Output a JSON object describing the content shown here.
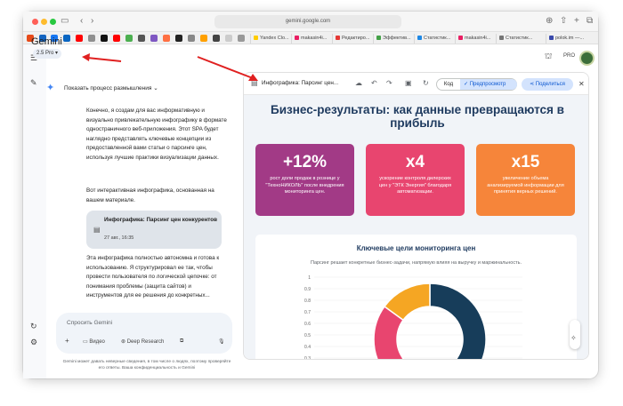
{
  "browser": {
    "url": "gemini.google.com",
    "tabs": [
      "Yandex Clo...",
      "makasin4i...",
      "Редактиро...",
      "Эффектив...",
      "Статистик...",
      "makasin4i...",
      "Статистик...",
      "polok.im —..."
    ]
  },
  "app": {
    "title": "Gemini",
    "model": "2.5 Pro",
    "pro_label": "PRO"
  },
  "chat": {
    "thinking_label": "Показать процесс размышления",
    "para1": "Конечно, я создам для вас информативную и визуально привлекательную инфографику в формате одностраничного веб-приложения. Этот SPA будет наглядно представлять ключевые концепции из предоставленной вами статьи о парсинге цен, используя лучшие практики визуализации данных.",
    "para2": "Вот интерактивная инфографика, основанная на вашем материале.",
    "card_title": "Инфографика: Парсинг цен конкурентов",
    "card_date": "27 авг., 16:35",
    "para3": "Эта инфографика полностью автономна и готова к использованию. Я структурировал ее так, чтобы провести пользователя по логической цепочке: от понимания проблемы (защита сайтов) и инструментов для ее решения до конкретных..."
  },
  "composer": {
    "placeholder": "Спросить Gemini",
    "video": "Видео",
    "deep_research": "Deep Research"
  },
  "disclaimer": "Gemini может давать неверные сведения, в том числе о людях, поэтому проверяйте его ответы. Ваша конфиденциальность и Gemini",
  "panel": {
    "title": "Инфографика: Парсинг цен...",
    "code_label": "Код",
    "preview_label": "Предпросмотр",
    "share_label": "Поделиться",
    "headline": "Бизнес-результаты: как данные превращаются в прибыль",
    "stats": [
      {
        "value": "+12%",
        "desc": "рост доли продаж в рознице у \"ТехноНИКОЛЬ\" после внедрения мониторинга цен.",
        "color": "#a23a86"
      },
      {
        "value": "x4",
        "desc": "ускорение контроля дилерских цен у \"ЭТК Энергия\" благодаря автоматизации.",
        "color": "#e8456f"
      },
      {
        "value": "x15",
        "desc": "увеличение объема анализируемой информации для принятия верных решений.",
        "color": "#f6853a"
      }
    ],
    "goals_title": "Ключевые цели мониторинга цен",
    "goals_subtitle": "Парсинг решает конкретные бизнес-задачи, напрямую влияя на выручку и маржинальность."
  },
  "chart_data": {
    "type": "pie",
    "title": "Ключевые цели мониторинга цен",
    "y_ticks": [
      "1",
      "0.9",
      "0.8",
      "0.7",
      "0.6",
      "0.5",
      "0.4",
      "0.3"
    ],
    "values": [
      40,
      25,
      20,
      15
    ],
    "colors": [
      "#173d5a",
      "#6e3b83",
      "#e8456f",
      "#f5a623"
    ]
  },
  "colors": {
    "accent": "#0b57d0",
    "headline": "#1e3a5f",
    "panel_bg": "#f1f4f8"
  }
}
